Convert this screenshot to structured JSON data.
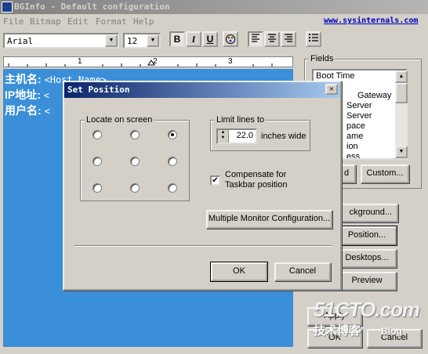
{
  "app": {
    "title": "BGInfo - Default configuration"
  },
  "menu": {
    "items": [
      "File",
      "Bitmap",
      "Edit",
      "Format",
      "Help"
    ],
    "link": "www.sysinternals.com"
  },
  "toolbar": {
    "font": "Arial",
    "size": "12",
    "bold": "B",
    "italic": "I",
    "underline": "U",
    "color_icon": "palette-icon"
  },
  "ruler": {
    "labels": [
      "1",
      "2",
      "3"
    ]
  },
  "editor": {
    "lines": [
      {
        "label": "主机名:",
        "tag": "<Host Name>"
      },
      {
        "label": "IP地址:",
        "tag": "<"
      },
      {
        "label": "用户名:",
        "tag": "<"
      }
    ]
  },
  "fields": {
    "legend": "Fields",
    "items": [
      "Boot Time",
      "",
      "Gateway",
      "Server",
      "Server",
      "pace",
      "ame",
      "ion",
      "ess"
    ],
    "custom_button": "Custom...",
    "add_button": "d"
  },
  "side_buttons": {
    "background": "ckground...",
    "position": "Position...",
    "desktops": "Desktops...",
    "preview": "Preview",
    "apply": "Apply",
    "ok": "OK",
    "cancel": "Cancel"
  },
  "dialog": {
    "title": "Set Position",
    "locate_legend": "Locate on screen",
    "selected_position": "top-right",
    "limit_legend": "Limit lines to",
    "limit_value": "22.0",
    "limit_unit": "inches wide",
    "compensate_label_line1": "Compensate for",
    "compensate_label_line2": "Taskbar position",
    "compensate_checked": true,
    "multi_monitor_button": "Multiple Monitor Configuration...",
    "ok_button": "OK",
    "cancel_button": "Cancel"
  },
  "watermark": {
    "line1": "51CTO.com",
    "line2": "技术博客",
    "line3": "Blog"
  }
}
